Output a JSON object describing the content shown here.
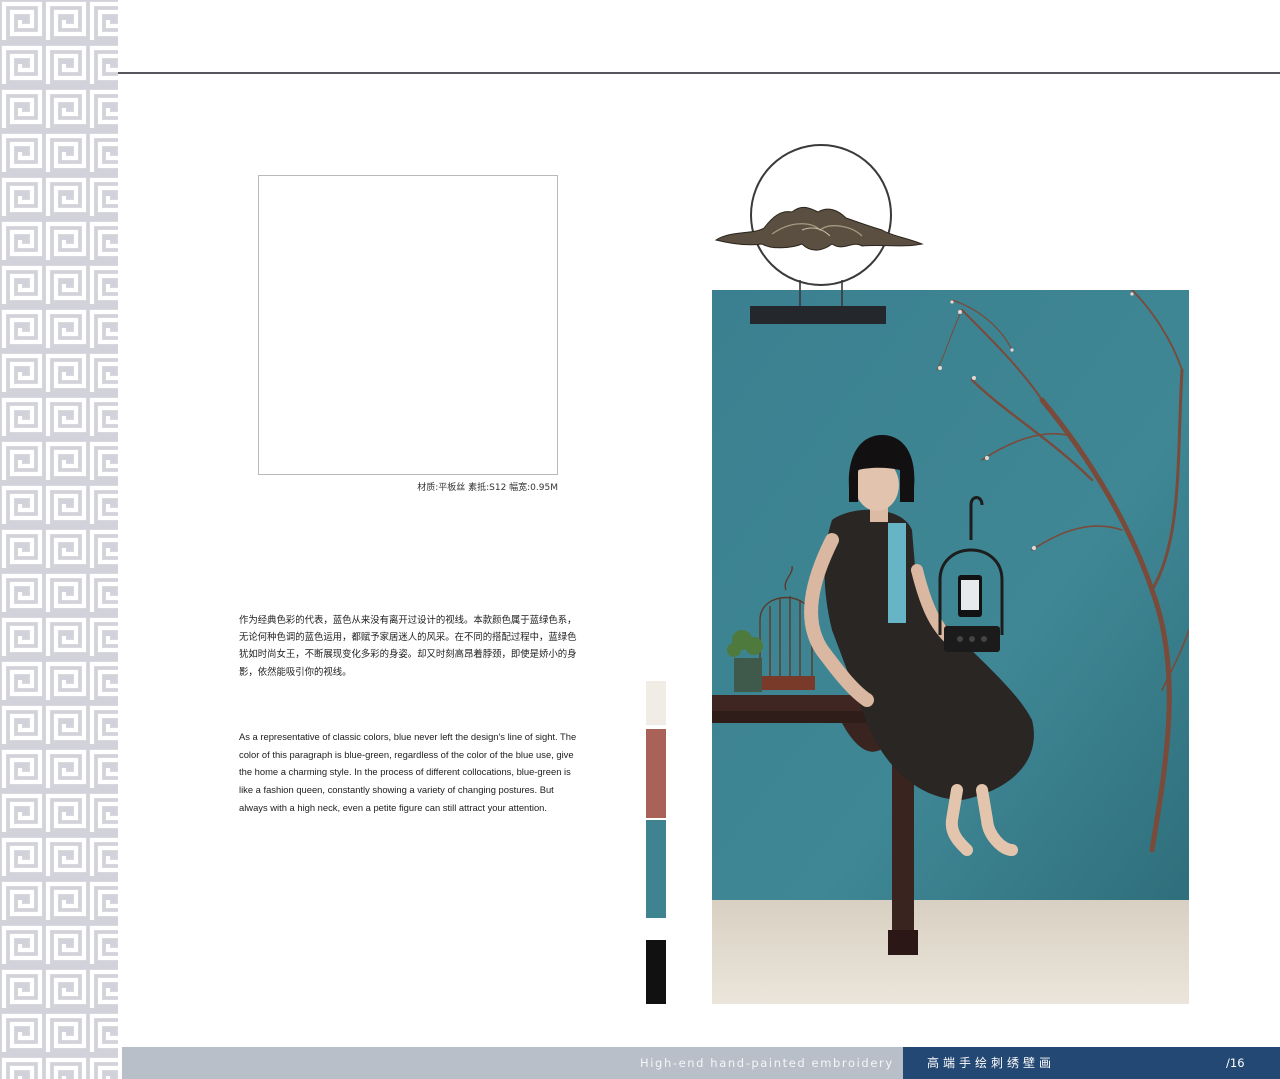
{
  "caption": "材质:平板丝  素抵:S12  幅宽:0.95M",
  "paragraph_cn": "作为经典色彩的代表，蓝色从来没有离开过设计的视线。本款颜色属于蓝绿色系，无论何种色调的蓝色运用，都赋予家居迷人的风采。在不同的搭配过程中，蓝绿色犹如时尚女王，不断展现变化多彩的身姿。却又时刻高昂着脖颈，即使是娇小的身影，依然能吸引你的视线。",
  "paragraph_en": "As a representative of classic colors, blue never left the design's line of sight. The color of this paragraph is blue-green, regardless of the color of the blue use, give the home a charming style. In the process of different collocations, blue-green is like a fashion queen, constantly showing a variety of changing postures. But always with a high neck, even a petite figure can still attract your attention.",
  "swatches": [
    "#f1ece6",
    "#a96258",
    "#3f8391",
    "#111111"
  ],
  "colors": {
    "pattern_bg": "#d2d3da",
    "top_rule": "#55575c",
    "bottom_bar": "#b8bfc8",
    "title_box": "#234873",
    "photo_wall": "#3f8795",
    "photo_floor": "#e5ddd0"
  },
  "footer": {
    "english_title": "High-end hand-painted embroidery",
    "chinese_title": "高端手绘刺绣壁画",
    "page_number": "/16"
  }
}
